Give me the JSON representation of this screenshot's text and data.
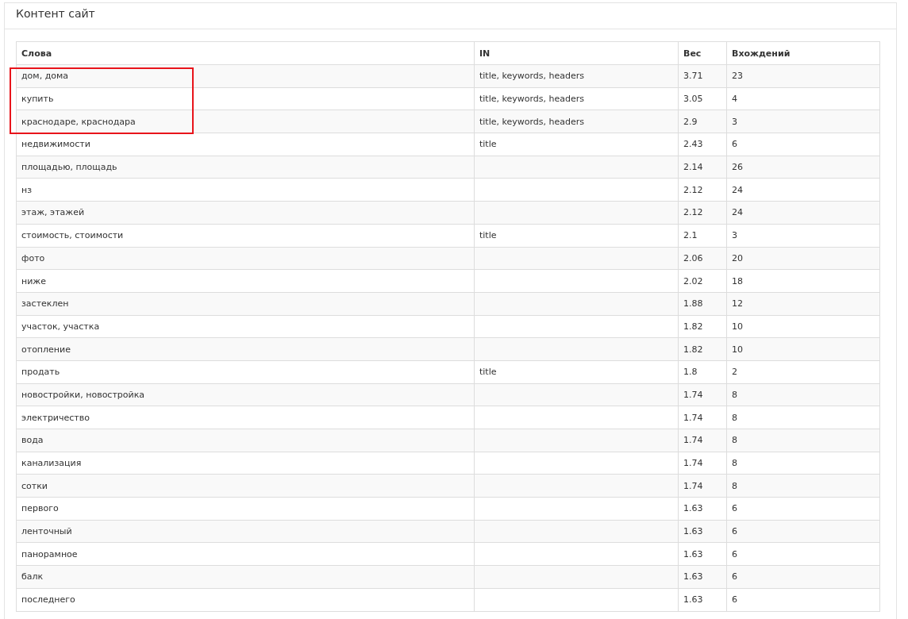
{
  "panel": {
    "title": "Контент сайт"
  },
  "table": {
    "columns": [
      "Слова",
      "IN",
      "Вес",
      "Вхождений"
    ],
    "rows": [
      {
        "cells": [
          "дом, дома",
          "title, keywords, headers",
          "3.71",
          "23"
        ],
        "highlighted": true
      },
      {
        "cells": [
          "купить",
          "title, keywords, headers",
          "3.05",
          "4"
        ],
        "highlighted": true
      },
      {
        "cells": [
          "краснодаре, краснодара",
          "title, keywords, headers",
          "2.9",
          "3"
        ],
        "highlighted": true
      },
      {
        "cells": [
          "недвижимости",
          "title",
          "2.43",
          "6"
        ],
        "highlighted": false
      },
      {
        "cells": [
          "площадью, площадь",
          "",
          "2.14",
          "26"
        ],
        "highlighted": false
      },
      {
        "cells": [
          "нз",
          "",
          "2.12",
          "24"
        ],
        "highlighted": false
      },
      {
        "cells": [
          "этаж, этажей",
          "",
          "2.12",
          "24"
        ],
        "highlighted": false
      },
      {
        "cells": [
          "стоимость, стоимости",
          "title",
          "2.1",
          "3"
        ],
        "highlighted": false
      },
      {
        "cells": [
          "фото",
          "",
          "2.06",
          "20"
        ],
        "highlighted": false
      },
      {
        "cells": [
          "ниже",
          "",
          "2.02",
          "18"
        ],
        "highlighted": false
      },
      {
        "cells": [
          "застеклен",
          "",
          "1.88",
          "12"
        ],
        "highlighted": false
      },
      {
        "cells": [
          "участок, участка",
          "",
          "1.82",
          "10"
        ],
        "highlighted": false
      },
      {
        "cells": [
          "отопление",
          "",
          "1.82",
          "10"
        ],
        "highlighted": false
      },
      {
        "cells": [
          "продать",
          "title",
          "1.8",
          "2"
        ],
        "highlighted": false
      },
      {
        "cells": [
          "новостройки, новостройка",
          "",
          "1.74",
          "8"
        ],
        "highlighted": false
      },
      {
        "cells": [
          "электричество",
          "",
          "1.74",
          "8"
        ],
        "highlighted": false
      },
      {
        "cells": [
          "вода",
          "",
          "1.74",
          "8"
        ],
        "highlighted": false
      },
      {
        "cells": [
          "канализация",
          "",
          "1.74",
          "8"
        ],
        "highlighted": false
      },
      {
        "cells": [
          "сотки",
          "",
          "1.74",
          "8"
        ],
        "highlighted": false
      },
      {
        "cells": [
          "первого",
          "",
          "1.63",
          "6"
        ],
        "highlighted": false
      },
      {
        "cells": [
          "ленточный",
          "",
          "1.63",
          "6"
        ],
        "highlighted": false
      },
      {
        "cells": [
          "панорамное",
          "",
          "1.63",
          "6"
        ],
        "highlighted": false
      },
      {
        "cells": [
          "балк",
          "",
          "1.63",
          "6"
        ],
        "highlighted": false
      },
      {
        "cells": [
          "последнего",
          "",
          "1.63",
          "6"
        ],
        "highlighted": false
      }
    ]
  }
}
